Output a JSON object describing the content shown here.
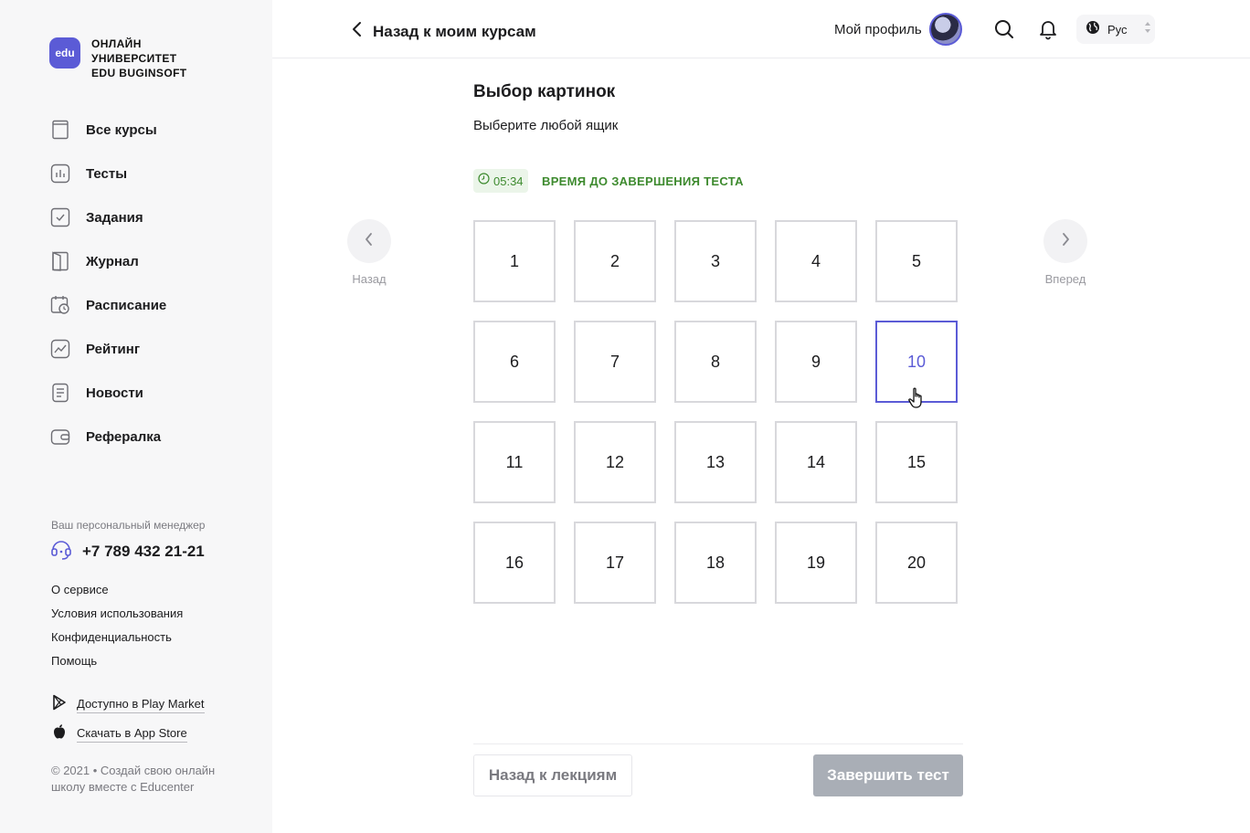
{
  "brand": {
    "logo_mark": "edu",
    "line1": "ОНЛАЙН",
    "line2": "УНИВЕРСИТЕТ",
    "line3": "EDU BUGINSOFT",
    "accent_color": "#5b5bd6"
  },
  "sidebar": {
    "items": [
      {
        "label": "Все курсы",
        "icon": "book-icon"
      },
      {
        "label": "Тесты",
        "icon": "bar-chart-icon"
      },
      {
        "label": "Задания",
        "icon": "checkbox-icon"
      },
      {
        "label": "Журнал",
        "icon": "journal-icon"
      },
      {
        "label": "Расписание",
        "icon": "calendar-clock-icon"
      },
      {
        "label": "Рейтинг",
        "icon": "trend-chart-icon"
      },
      {
        "label": "Новости",
        "icon": "news-icon"
      },
      {
        "label": "Рефералка",
        "icon": "wallet-icon"
      }
    ],
    "manager_caption": "Ваш персональный  менеджер",
    "manager_phone": "+7 789 432 21-21",
    "links": [
      "О сервисе",
      "Условия использования",
      "Конфиденциальность",
      "Помощь"
    ],
    "play_market": "Доступно в Play Market",
    "app_store": "Скачать в App Store",
    "copyright": "© 2021 • Создай свою онлайн школу вместе с Educenter"
  },
  "header": {
    "back_label": "Назад к моим курсам",
    "profile_label": "Мой профиль",
    "language": "Рус"
  },
  "main": {
    "title": "Выбор картинок",
    "subtitle": "Выберите любой ящик",
    "timer_value": "05:34",
    "timer_label": "ВРЕМЯ ДО ЗАВЕРШЕНИЯ ТЕСТА",
    "timer_color": "#3d8a2e",
    "prev_label": "Назад",
    "next_label": "Вперед",
    "boxes": [
      "1",
      "2",
      "3",
      "4",
      "5",
      "6",
      "7",
      "8",
      "9",
      "10",
      "11",
      "12",
      "13",
      "14",
      "15",
      "16",
      "17",
      "18",
      "19",
      "20"
    ],
    "selected_box": "10",
    "btn_back_lectures": "Назад к лекциям",
    "btn_finish": "Завершить тест"
  }
}
